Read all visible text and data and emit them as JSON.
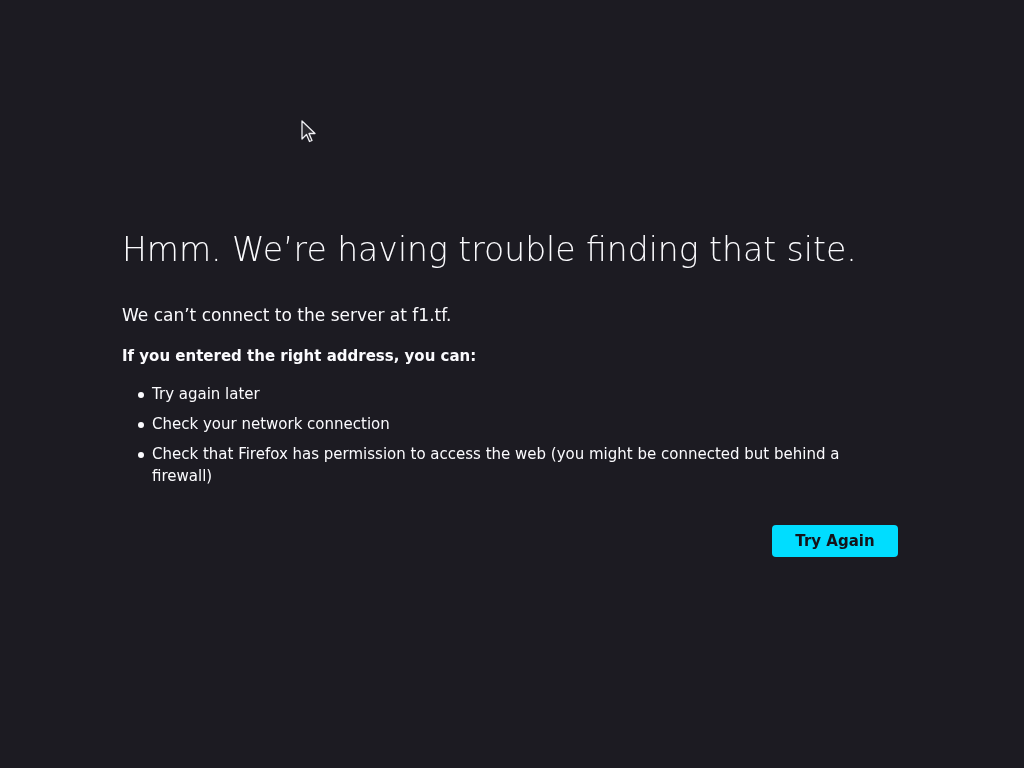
{
  "title": "Hmm. We’re having trouble finding that site.",
  "message": "We can’t connect to the server at f1.tf.",
  "advice": {
    "heading": "If you entered the right address, you can:",
    "items": [
      "Try again later",
      "Check your network connection",
      "Check that Firefox has permission to access the web (you might be connected but behind a firewall)"
    ]
  },
  "button": {
    "label": "Try Again"
  }
}
